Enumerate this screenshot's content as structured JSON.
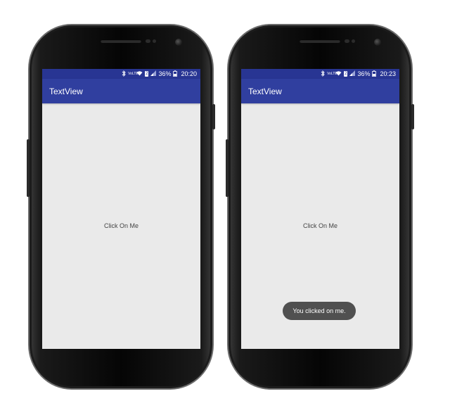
{
  "devices": [
    {
      "status_bar": {
        "bluetooth_icon": "bluetooth-icon",
        "lte_label": "VoLTE",
        "wifi_icon": "wifi-icon",
        "sim_label": "2",
        "signal_icon": "signal-icon",
        "battery_percent": "36%",
        "battery_icon": "battery-icon",
        "time": "20:20"
      },
      "app_bar": {
        "title": "TextView"
      },
      "content": {
        "text_view": "Click On Me"
      }
    },
    {
      "status_bar": {
        "bluetooth_icon": "bluetooth-icon",
        "lte_label": "VoLTE",
        "wifi_icon": "wifi-icon",
        "sim_label": "2",
        "signal_icon": "signal-icon",
        "battery_percent": "36%",
        "battery_icon": "battery-icon",
        "time": "20:23"
      },
      "app_bar": {
        "title": "TextView"
      },
      "content": {
        "text_view": "Click On Me",
        "toast": "You clicked on me."
      }
    }
  ],
  "colors": {
    "status_bar": "#283593",
    "app_bar": "#303f9f",
    "screen_background": "#eaeaea",
    "toast_background": "#505050"
  }
}
